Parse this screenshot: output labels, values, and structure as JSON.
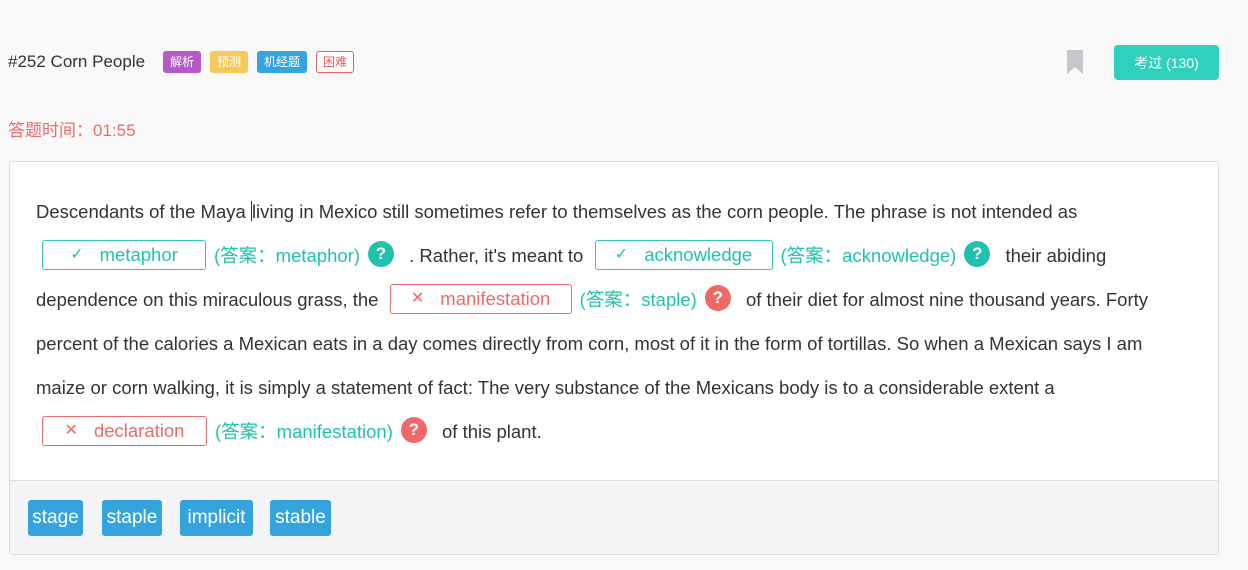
{
  "header": {
    "title": "#252 Corn People",
    "tags": [
      "解析",
      "预测",
      "机经题",
      "困难"
    ],
    "pass_button": "考过 (130)"
  },
  "timer": {
    "label": "答题时间：",
    "value": "01:55"
  },
  "passage": {
    "seg1a": "Descendants of the Maya ",
    "seg1b": "living in Mexico still sometimes refer to themselves as the corn people. The phrase is not intended as",
    "seg2": ". Rather, it's meant to",
    "seg3": "their abiding dependence on this miraculous grass, the",
    "seg4": "of their diet for almost nine thousand years. Forty percent of the calories a Mexican eats in a day comes directly from corn, most of it in the form of tortillas. So when a Mexican says I am maize or corn walking, it is simply a statement of fact: The very substance of the Mexicans body is to a considerable extent a",
    "seg5": "of this plant."
  },
  "blanks": [
    {
      "mark": "✓",
      "value": "metaphor",
      "answer": "(答案：metaphor)",
      "status": "correct"
    },
    {
      "mark": "✓",
      "value": "acknowledge",
      "answer": "(答案：acknowledge)",
      "status": "correct"
    },
    {
      "mark": "✕",
      "value": "manifestation",
      "answer": "(答案：staple)",
      "status": "incorrect"
    },
    {
      "mark": "✕",
      "value": "declaration",
      "answer": "(答案：manifestation)",
      "status": "incorrect"
    }
  ],
  "help_icon_glyph": "?",
  "options": [
    "stage",
    "staple",
    "implicit",
    "stable"
  ],
  "colors": {
    "accent": "#2fd1bd",
    "correct": "#21c2ad",
    "wrong": "#ef6969",
    "option": "#34a4df"
  }
}
